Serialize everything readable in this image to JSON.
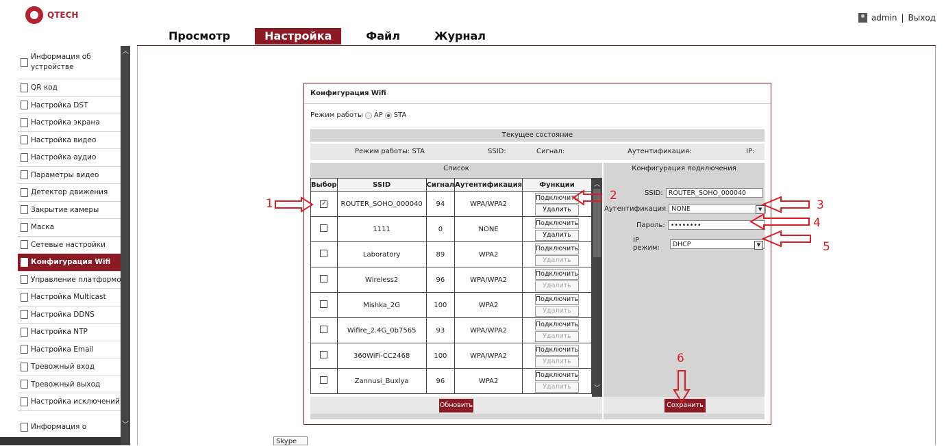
{
  "brand": "QTECH",
  "topnav": [
    {
      "label": "Просмотр",
      "active": false
    },
    {
      "label": "Настройка",
      "active": true
    },
    {
      "label": "Файл",
      "active": false
    },
    {
      "label": "Журнал",
      "active": false
    }
  ],
  "user": {
    "name": "admin",
    "separator": "|",
    "logout": "Выход"
  },
  "sidebar": {
    "items": [
      {
        "label": "Информация об устройстве"
      },
      {
        "label": "QR код"
      },
      {
        "label": "Настройка DST"
      },
      {
        "label": "Настройка экрана"
      },
      {
        "label": "Настройка видео"
      },
      {
        "label": "Настройка аудио"
      },
      {
        "label": "Параметры видео"
      },
      {
        "label": "Детектор движения"
      },
      {
        "label": "Закрытие камеры"
      },
      {
        "label": "Маска"
      },
      {
        "label": "Сетевые настройки"
      },
      {
        "label": "Конфигурация Wifi"
      },
      {
        "label": "Управление платформой"
      },
      {
        "label": "Настройка Multicast"
      },
      {
        "label": "Настройка DDNS"
      },
      {
        "label": "Настройка NTP"
      },
      {
        "label": "Настройка Email"
      },
      {
        "label": "Тревожный вход"
      },
      {
        "label": "Тревожный выход"
      },
      {
        "label": "Настройка исключений"
      },
      {
        "label": "Информация о"
      }
    ]
  },
  "panel": {
    "title": "Конфигурация Wifi",
    "mode_label": "Режим работы",
    "mode_ap": "AP",
    "mode_sta": "STA",
    "mode_selected": "STA",
    "status": {
      "title": "Текущее состояние",
      "mode": "Режим работы: STA",
      "ssid": "SSID:",
      "signal": "Сигнал:",
      "auth": "Аутентификация:",
      "ip": "IP:"
    },
    "list": {
      "title": "Список",
      "headers": [
        "Выбор",
        "SSID",
        "Сигнал",
        "Аутентификация",
        "Функции"
      ],
      "connect_label": "Подключить",
      "delete_label": "Удалить",
      "rows": [
        {
          "checked": true,
          "ssid": "ROUTER_SOHO_000040",
          "signal": "94",
          "auth": "WPA/WPA2",
          "delete_enabled": true
        },
        {
          "checked": false,
          "ssid": "1111",
          "signal": "0",
          "auth": "NONE",
          "delete_enabled": true
        },
        {
          "checked": false,
          "ssid": "Laboratory",
          "signal": "89",
          "auth": "WPA2",
          "delete_enabled": false
        },
        {
          "checked": false,
          "ssid": "Wireless2",
          "signal": "96",
          "auth": "WPA/WPA2",
          "delete_enabled": false
        },
        {
          "checked": false,
          "ssid": "Mishka_2G",
          "signal": "100",
          "auth": "WPA2",
          "delete_enabled": false
        },
        {
          "checked": false,
          "ssid": "Wifire_2.4G_0b7565",
          "signal": "93",
          "auth": "WPA/WPA2",
          "delete_enabled": false
        },
        {
          "checked": false,
          "ssid": "360WiFi-CC2468",
          "signal": "100",
          "auth": "WPA/WPA2",
          "delete_enabled": false
        },
        {
          "checked": false,
          "ssid": "Zannusi_Buxlya",
          "signal": "96",
          "auth": "WPA2",
          "delete_enabled": false
        }
      ],
      "refresh_label": "Обновить"
    },
    "config": {
      "title": "Конфигурация подключения",
      "ssid_label": "SSID:",
      "ssid_value": "ROUTER_SOHO_000040",
      "auth_label": "Аутентификация",
      "auth_value": "NONE",
      "password_label": "Пароль:",
      "password_value": "••••••••",
      "ip_label": "IP режим:",
      "ip_value": "DHCP",
      "save_label": "Сохранить"
    }
  },
  "annotations": [
    "1",
    "2",
    "3",
    "4",
    "5",
    "6"
  ],
  "taskbar_tooltip": "Skype",
  "colors": {
    "accent": "#8b1a25",
    "annotation": "#e01b24"
  }
}
